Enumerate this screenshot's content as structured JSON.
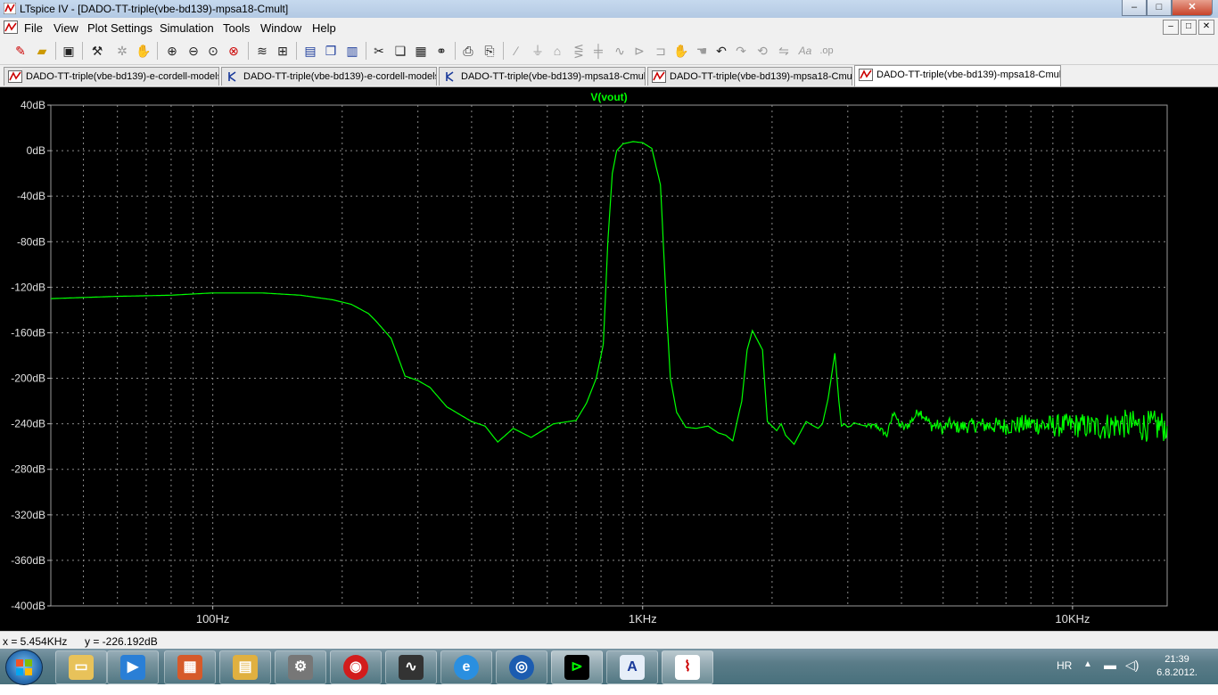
{
  "window": {
    "title": "LTspice IV - [DADO-TT-triple(vbe-bd139)-mpsa18-Cmult]",
    "buttons": {
      "minimize": "–",
      "maximize": "□",
      "close": "✕"
    }
  },
  "menu": {
    "items": [
      "File",
      "View",
      "Plot Settings",
      "Simulation",
      "Tools",
      "Window",
      "Help"
    ]
  },
  "toolbar": {
    "icons": [
      "new-schematic-icon",
      "open-icon",
      "save-icon",
      "control-panel-icon",
      "run-icon",
      "halt-icon",
      "zoom-in-icon",
      "zoom-out-icon",
      "zoom-fit-icon",
      "zoom-cancel-icon",
      "autorange-icon",
      "grid-icon",
      "tile-horizontal-icon",
      "cascade-icon",
      "tile-vertical-icon",
      "cut-icon",
      "copy-icon",
      "paste-icon",
      "find-icon",
      "print-icon",
      "print-setup-icon",
      "wire-icon",
      "ground-icon",
      "label-icon",
      "resistor-icon",
      "capacitor-icon",
      "inductor-icon",
      "diode-icon",
      "component-icon",
      "move-icon",
      "drag-icon",
      "undo-icon",
      "redo-icon",
      "rotate-icon",
      "mirror-icon",
      "text-icon",
      "spice-directive-icon"
    ]
  },
  "tabs": [
    {
      "label": "DADO-TT-triple(vbe-bd139)-e-cordell-models",
      "type": "plot",
      "active": false
    },
    {
      "label": "DADO-TT-triple(vbe-bd139)-e-cordell-models",
      "type": "schematic",
      "active": false
    },
    {
      "label": "DADO-TT-triple(vbe-bd139)-mpsa18-Cmult",
      "type": "schematic",
      "active": false
    },
    {
      "label": "DADO-TT-triple(vbe-bd139)-mpsa18-Cmult",
      "type": "plot",
      "active": false
    },
    {
      "label": "DADO-TT-triple(vbe-bd139)-mpsa18-Cmult",
      "type": "plot",
      "active": true
    }
  ],
  "status": {
    "x_readout": "x = 5.454KHz",
    "y_readout": "y = -226.192dB"
  },
  "taskbar": {
    "items": [
      "windows-explorer-icon",
      "media-player-icon",
      "installer-icon",
      "file-manager-icon",
      "network-icon",
      "antivirus-icon",
      "oscilloscope-icon",
      "internet-explorer-icon",
      "media-icon",
      "ltspice-schematic-icon",
      "wordpad-icon",
      "ltspice-icon"
    ],
    "language": "HR",
    "time": "21:39",
    "date": "6.8.2012."
  },
  "colors": {
    "plot_background": "#000000",
    "trace": "#00ff00",
    "grid": "#9a9a9a",
    "title_text": "#00ff00",
    "axis_text": "#e0e0e0"
  },
  "chart_data": {
    "type": "line",
    "title": "V(vout)",
    "xlabel": "",
    "ylabel": "",
    "x_scale": "log",
    "xlim": [
      42,
      16600
    ],
    "ylim": [
      -400,
      40
    ],
    "grid": true,
    "y_ticks": [
      {
        "value": 40,
        "label": "40dB"
      },
      {
        "value": 0,
        "label": "0dB"
      },
      {
        "value": -40,
        "label": "-40dB"
      },
      {
        "value": -80,
        "label": "-80dB"
      },
      {
        "value": -120,
        "label": "-120dB"
      },
      {
        "value": -160,
        "label": "-160dB"
      },
      {
        "value": -200,
        "label": "-200dB"
      },
      {
        "value": -240,
        "label": "-240dB"
      },
      {
        "value": -280,
        "label": "-280dB"
      },
      {
        "value": -320,
        "label": "-320dB"
      },
      {
        "value": -360,
        "label": "-360dB"
      },
      {
        "value": -400,
        "label": "-400dB"
      }
    ],
    "x_ticks": [
      {
        "value": 100,
        "label": "100Hz"
      },
      {
        "value": 1000,
        "label": "1KHz"
      },
      {
        "value": 10000,
        "label": "10KHz"
      }
    ],
    "series": [
      {
        "name": "V(vout)",
        "x": [
          42,
          60,
          80,
          100,
          130,
          160,
          190,
          210,
          230,
          240,
          260,
          280,
          300,
          320,
          350,
          400,
          430,
          460,
          500,
          550,
          620,
          700,
          740,
          780,
          810,
          830,
          850,
          870,
          900,
          950,
          1000,
          1050,
          1100,
          1140,
          1160,
          1200,
          1260,
          1330,
          1420,
          1500,
          1560,
          1620,
          1700,
          1750,
          1800,
          1900,
          1950,
          2000,
          2050,
          2100,
          2150,
          2250,
          2400,
          2500,
          2560,
          2620,
          2700,
          2800,
          2860,
          2900,
          2950,
          3000,
          3050,
          3100,
          3150,
          3300,
          3500,
          3700,
          3850,
          3950,
          4000,
          4050,
          4150,
          4400,
          4700,
          4850,
          5000,
          5150,
          5400,
          6000,
          7000,
          8000,
          9000,
          10000,
          11500,
          13000,
          14500,
          16600
        ],
        "y": [
          -130,
          -128,
          -127,
          -125,
          -125,
          -127,
          -131,
          -135,
          -143,
          -150,
          -165,
          -198,
          -202,
          -208,
          -225,
          -238,
          -242,
          -256,
          -244,
          -252,
          -240,
          -237,
          -222,
          -200,
          -170,
          -80,
          -20,
          0,
          6,
          8,
          7,
          2,
          -30,
          -150,
          -200,
          -230,
          -243,
          -244,
          -242,
          -248,
          -250,
          -255,
          -220,
          -175,
          -158,
          -175,
          -238,
          -242,
          -246,
          -240,
          -250,
          -258,
          -238,
          -242,
          -244,
          -240,
          -218,
          -178,
          -220,
          -242,
          -240,
          -243,
          -242,
          -239,
          -240,
          -242,
          -242,
          -250,
          -228,
          -242,
          -240,
          -244,
          -241,
          -228,
          -242,
          -241,
          -245,
          -240,
          -243,
          -241,
          -242,
          -240,
          -242,
          -241,
          -243,
          -240,
          -242,
          -242
        ]
      }
    ]
  }
}
